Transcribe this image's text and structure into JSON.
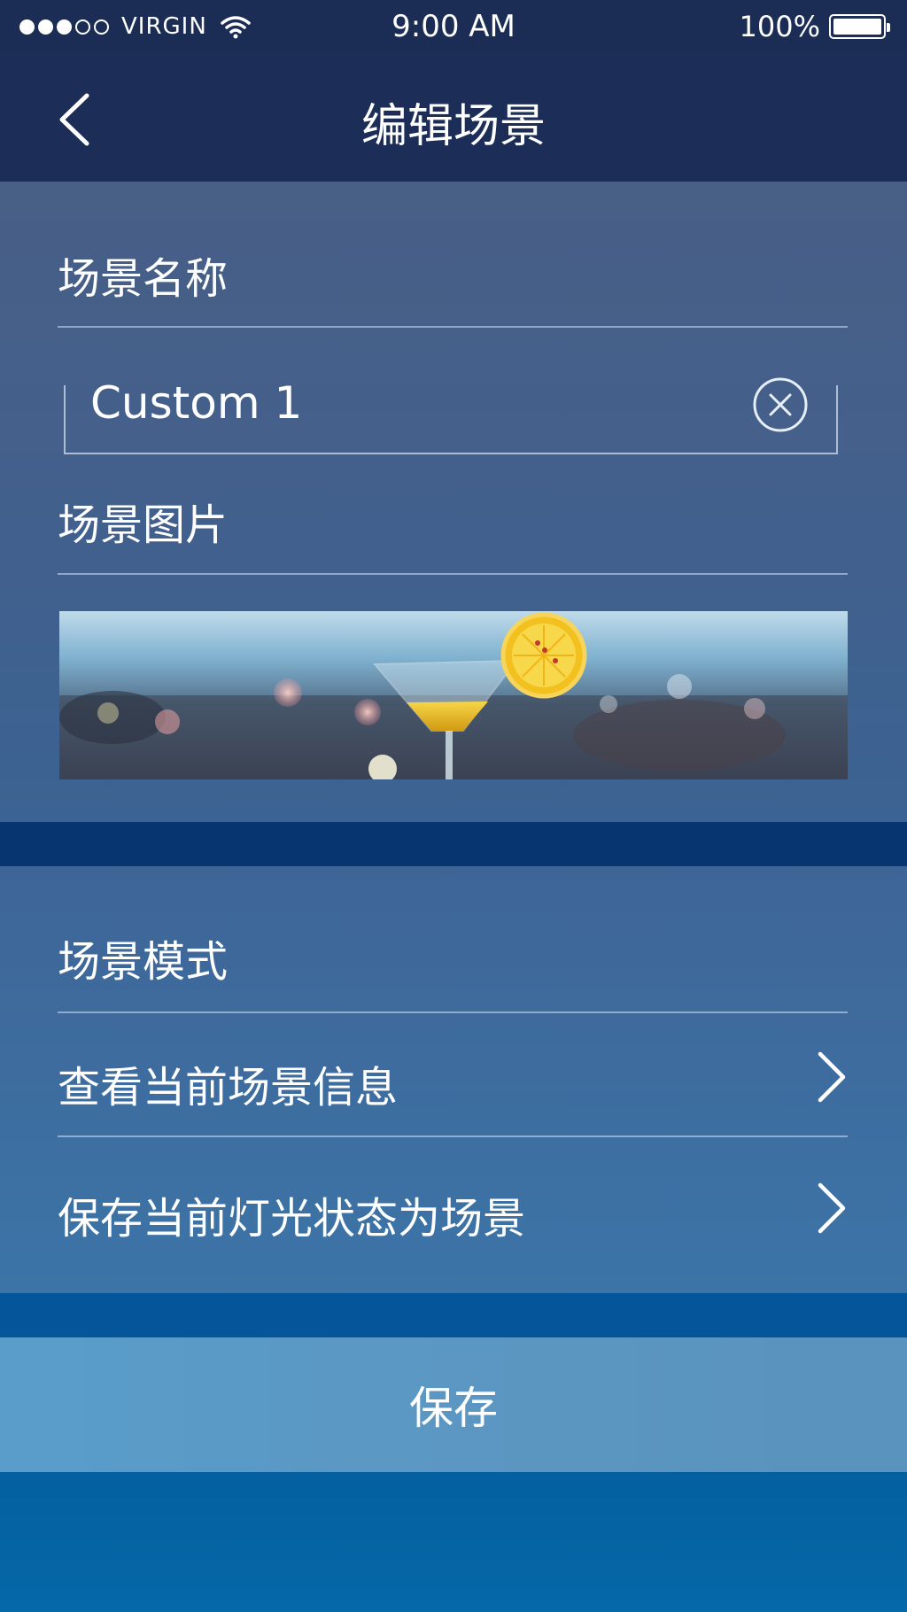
{
  "status_bar": {
    "carrier": "VIRGIN",
    "time": "9:00 AM",
    "battery": "100%",
    "signal_bars_filled": 3,
    "signal_bars_total": 5
  },
  "nav": {
    "title": "编辑场景",
    "back_icon": "chevron-left-icon"
  },
  "scene_name": {
    "label": "场景名称",
    "value": "Custom 1",
    "clear_icon": "close-circle-icon"
  },
  "scene_image": {
    "label": "场景图片"
  },
  "scene_mode": {
    "label": "场景模式",
    "items": [
      {
        "label": "查看当前场景信息",
        "icon": "chevron-right-icon"
      },
      {
        "label": "保存当前灯光状态为场景",
        "icon": "chevron-right-icon"
      }
    ]
  },
  "actions": {
    "save_label": "保存"
  },
  "colors": {
    "nav_bg": "#1c2e57",
    "band": "#073570",
    "save_bg": "#5a9dcb"
  }
}
